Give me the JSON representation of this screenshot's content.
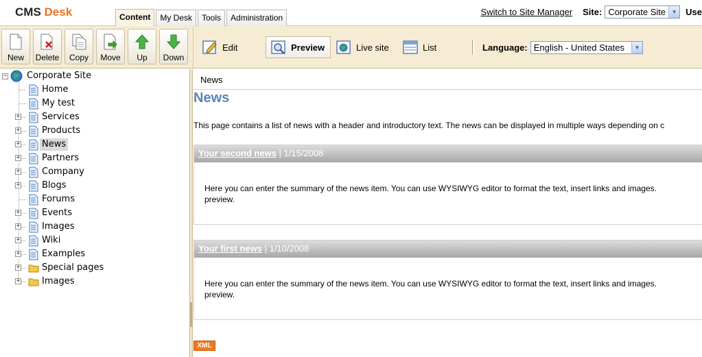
{
  "header": {
    "logo_cms": "CMS",
    "logo_desk": "Desk",
    "tabs": [
      "Content",
      "My Desk",
      "Tools",
      "Administration"
    ],
    "switch_link": "Switch to Site Manager",
    "site_label": "Site:",
    "site_value": "Corporate Site",
    "user_label_partial": "Use"
  },
  "toolbar": {
    "new": "New",
    "delete": "Delete",
    "copy": "Copy",
    "move": "Move",
    "up": "Up",
    "down": "Down"
  },
  "modes": {
    "edit": "Edit",
    "preview": "Preview",
    "live_site": "Live site",
    "list": "List",
    "active": "preview"
  },
  "language": {
    "label": "Language:",
    "value": "English - United States"
  },
  "tree": {
    "root": "Corporate Site",
    "items": [
      {
        "label": "Home",
        "expandable": false,
        "icon": "page-icon"
      },
      {
        "label": "My test",
        "expandable": false,
        "icon": "page-icon"
      },
      {
        "label": "Services",
        "expandable": true,
        "icon": "page-icon"
      },
      {
        "label": "Products",
        "expandable": true,
        "icon": "page-icon"
      },
      {
        "label": "News",
        "expandable": true,
        "icon": "page-icon",
        "selected": true
      },
      {
        "label": "Partners",
        "expandable": true,
        "icon": "page-icon"
      },
      {
        "label": "Company",
        "expandable": true,
        "icon": "page-icon"
      },
      {
        "label": "Blogs",
        "expandable": true,
        "icon": "page-icon"
      },
      {
        "label": "Forums",
        "expandable": false,
        "icon": "page-icon"
      },
      {
        "label": "Events",
        "expandable": true,
        "icon": "page-icon"
      },
      {
        "label": "Images",
        "expandable": true,
        "icon": "page-icon"
      },
      {
        "label": "Wiki",
        "expandable": true,
        "icon": "page-icon"
      },
      {
        "label": "Examples",
        "expandable": true,
        "icon": "page-icon"
      },
      {
        "label": "Special pages",
        "expandable": true,
        "icon": "folder-icon"
      },
      {
        "label": "Images",
        "expandable": true,
        "icon": "folder-icon"
      }
    ]
  },
  "content": {
    "breadcrumb": "News",
    "title": "News",
    "intro": "This page contains a list of news with a header and introductory text. The news can be displayed in multiple ways depending on c",
    "news": [
      {
        "title": "Your second news",
        "date": "1/15/2008",
        "summary_line1": "Here you can enter the summary of the news item. You can use WYSIWYG editor to format the text, insert links and images.",
        "summary_line2": "preview."
      },
      {
        "title": "Your first news",
        "date": "1/10/2008",
        "summary_line1": "Here you can enter the summary of the news item. You can use WYSIWYG editor to format the text, insert links and images.",
        "summary_line2": "preview."
      }
    ],
    "xml_badge": "XML",
    "date_separator": "|"
  },
  "colors": {
    "accent_orange": "#e8741e",
    "toolbar_bg": "#f6ebd3",
    "title_blue": "#5b83b9"
  }
}
